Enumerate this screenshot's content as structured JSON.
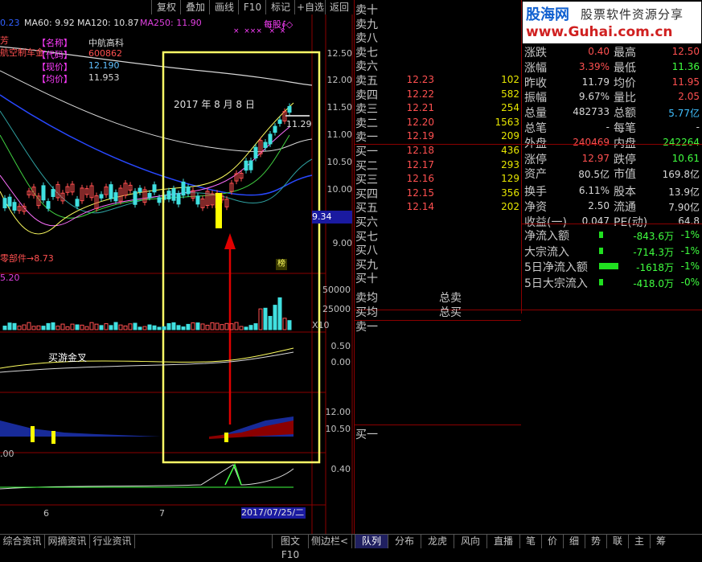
{
  "toolbar": {
    "buttons": [
      "复权",
      "叠加",
      "画线",
      "F10",
      "标记",
      "+自选",
      "返回"
    ]
  },
  "ma_line": {
    "prefix": "0.23",
    "ma60": "MA60: 9.92",
    "ma120": "MA120: 10.87",
    "ma250": "MA250: 11.90"
  },
  "stock_info": {
    "label_name": "【名称】",
    "name": "中航高科",
    "label_code": "【代码】",
    "code": "600862",
    "label_price": "【现价】",
    "price": "12.190",
    "label_avg": "【均价】",
    "avg": "11.953",
    "left_fragment_1": "芳",
    "left_fragment_2": "航空制车金"
  },
  "annotations": {
    "date_note": "2017 年 8 月 8 日",
    "marker_top": "每股∮◇",
    "marker_x": "×  ×××   ×  ×",
    "price_flag": "11.29",
    "current_price_flag": "9.34",
    "low_marker": "零部件→8.73",
    "bang": "榜",
    "vol_value": "5.20",
    "indicator_label": "买游金叉",
    "x10": "X10",
    "left_00": ".00",
    "date_bottom": "2017/07/25/二"
  },
  "price_axis": [
    "12.50",
    "12.00",
    "11.50",
    "11.00",
    "10.50",
    "10.00",
    "9.00"
  ],
  "vol_axis": [
    "50000",
    "25000"
  ],
  "ind1_axis": [
    "0.50",
    "0.00"
  ],
  "ind2_axis": [
    "12.00",
    "10.50"
  ],
  "ind3_axis": [
    "0.40"
  ],
  "month_labels": [
    "6",
    "7"
  ],
  "logo": {
    "brand": "股海网",
    "slogan": "股票软件资源分享",
    "url": "www.Guhai.com.cn"
  },
  "order_book": {
    "asks": [
      {
        "label": "卖十",
        "price": "",
        "vol": ""
      },
      {
        "label": "卖九",
        "price": "",
        "vol": ""
      },
      {
        "label": "卖八",
        "price": "",
        "vol": ""
      },
      {
        "label": "卖七",
        "price": "",
        "vol": ""
      },
      {
        "label": "卖六",
        "price": "",
        "vol": ""
      },
      {
        "label": "卖五",
        "price": "12.23",
        "vol": "102"
      },
      {
        "label": "卖四",
        "price": "12.22",
        "vol": "582"
      },
      {
        "label": "卖三",
        "price": "12.21",
        "vol": "254"
      },
      {
        "label": "卖二",
        "price": "12.20",
        "vol": "1563"
      },
      {
        "label": "卖一",
        "price": "12.19",
        "vol": "209"
      }
    ],
    "bids": [
      {
        "label": "买一",
        "price": "12.18",
        "vol": "436"
      },
      {
        "label": "买二",
        "price": "12.17",
        "vol": "293"
      },
      {
        "label": "买三",
        "price": "12.16",
        "vol": "129"
      },
      {
        "label": "买四",
        "price": "12.15",
        "vol": "356"
      },
      {
        "label": "买五",
        "price": "12.14",
        "vol": "202"
      },
      {
        "label": "买六",
        "price": "",
        "vol": ""
      },
      {
        "label": "买七",
        "price": "",
        "vol": ""
      },
      {
        "label": "买八",
        "price": "",
        "vol": ""
      },
      {
        "label": "买九",
        "price": "",
        "vol": ""
      },
      {
        "label": "买十",
        "price": "",
        "vol": ""
      }
    ],
    "avg_sell": "卖均",
    "total_sell": "总卖",
    "avg_buy": "买均",
    "total_buy": "总买",
    "sell_one_2": "卖一",
    "buy_one_2": "买一"
  },
  "quote": {
    "rows": [
      {
        "l1": "涨跌",
        "v1": "0.40",
        "c1": "#ff5050",
        "l2": "最高",
        "v2": "12.50",
        "c2": "#ff5050"
      },
      {
        "l1": "涨幅",
        "v1": "3.39%",
        "c1": "#ff5050",
        "l2": "最低",
        "v2": "11.36",
        "c2": "#40ff40"
      },
      {
        "l1": "昨收",
        "v1": "11.79",
        "c1": "#d8d8d8",
        "l2": "均价",
        "v2": "11.95",
        "c2": "#ff5050"
      },
      {
        "l1": "振幅",
        "v1": "9.67%",
        "c1": "#d8d8d8",
        "l2": "量比",
        "v2": "2.05",
        "c2": "#ff5050"
      },
      {
        "l1": "总量",
        "v1": "482733",
        "c1": "#d8d8d8",
        "l2": "总额",
        "v2": "5.77亿",
        "c2": "#40c0ff"
      },
      {
        "l1": "总笔",
        "v1": "-",
        "c1": "#d8d8d8",
        "l2": "每笔",
        "v2": "-",
        "c2": "#d8d8d8"
      },
      {
        "l1": "外盘",
        "v1": "240469",
        "c1": "#ff5050",
        "l2": "内盘",
        "v2": "242264",
        "c2": "#40ff40"
      },
      {
        "l1": "涨停",
        "v1": "12.97",
        "c1": "#ff5050",
        "l2": "跌停",
        "v2": "10.61",
        "c2": "#40ff40"
      },
      {
        "l1": "资产",
        "v1": "80.5亿",
        "c1": "#d8d8d8",
        "l2": "市值",
        "v2": "169.8亿",
        "c2": "#d8d8d8"
      },
      {
        "l1": "换手",
        "v1": "6.11%",
        "c1": "#d8d8d8",
        "l2": "股本",
        "v2": "13.9亿",
        "c2": "#d8d8d8"
      },
      {
        "l1": "净资",
        "v1": "2.50",
        "c1": "#d8d8d8",
        "l2": "流通",
        "v2": "7.90亿",
        "c2": "#d8d8d8"
      },
      {
        "l1": "收益(一)",
        "v1": "0.047",
        "c1": "#d8d8d8",
        "l2": "PE(动)",
        "v2": "64.8",
        "c2": "#d8d8d8"
      }
    ]
  },
  "fund_flow": [
    {
      "label": "净流入额",
      "amount": "-843.6万",
      "pct": "-1%",
      "bar": 0.12
    },
    {
      "label": "大宗流入",
      "amount": "-714.3万",
      "pct": "-1%",
      "bar": 0.12
    },
    {
      "label": "5日净流入额",
      "amount": "-1618万",
      "pct": "-1%",
      "bar": 0.55
    },
    {
      "label": "5日大宗流入",
      "amount": "-418.0万",
      "pct": "-0%",
      "bar": 0.12
    }
  ],
  "bottom_tabs_left": [
    "综合资讯",
    "网摘资讯",
    "行业资讯"
  ],
  "bottom_mid": [
    "图文F10",
    "侧边栏<"
  ],
  "bottom_tabs_right": [
    "队列",
    "分布",
    "龙虎",
    "风向",
    "直播",
    "笔",
    "价",
    "细",
    "势",
    "联",
    "主",
    "筹"
  ],
  "colors": {
    "up": "#ff5050",
    "down": "#40ff40",
    "border": "#8b0000",
    "highlight": "#ffff66"
  }
}
